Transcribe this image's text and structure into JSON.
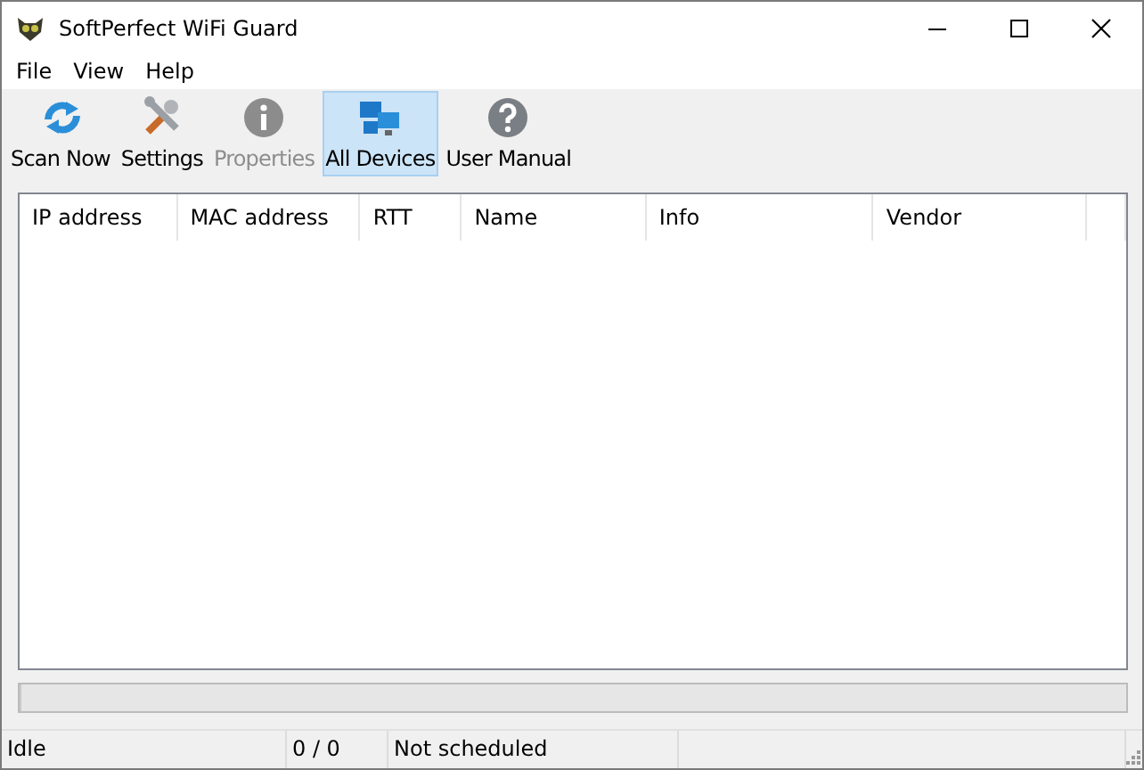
{
  "window": {
    "title": "SoftPerfect WiFi Guard"
  },
  "menu": [
    "File",
    "View",
    "Help"
  ],
  "toolbar": [
    {
      "label": "Scan Now",
      "disabled": false,
      "selected": false
    },
    {
      "label": "Settings",
      "disabled": false,
      "selected": false
    },
    {
      "label": "Properties",
      "disabled": true,
      "selected": false
    },
    {
      "label": "All Devices",
      "disabled": false,
      "selected": true
    },
    {
      "label": "User Manual",
      "disabled": false,
      "selected": false
    }
  ],
  "table": {
    "columns": [
      "IP address",
      "MAC address",
      "RTT",
      "Name",
      "Info",
      "Vendor"
    ]
  },
  "progress": {
    "level": 0
  },
  "status_bar": [
    "Idle",
    "0 / 0",
    "Not scheduled"
  ]
}
